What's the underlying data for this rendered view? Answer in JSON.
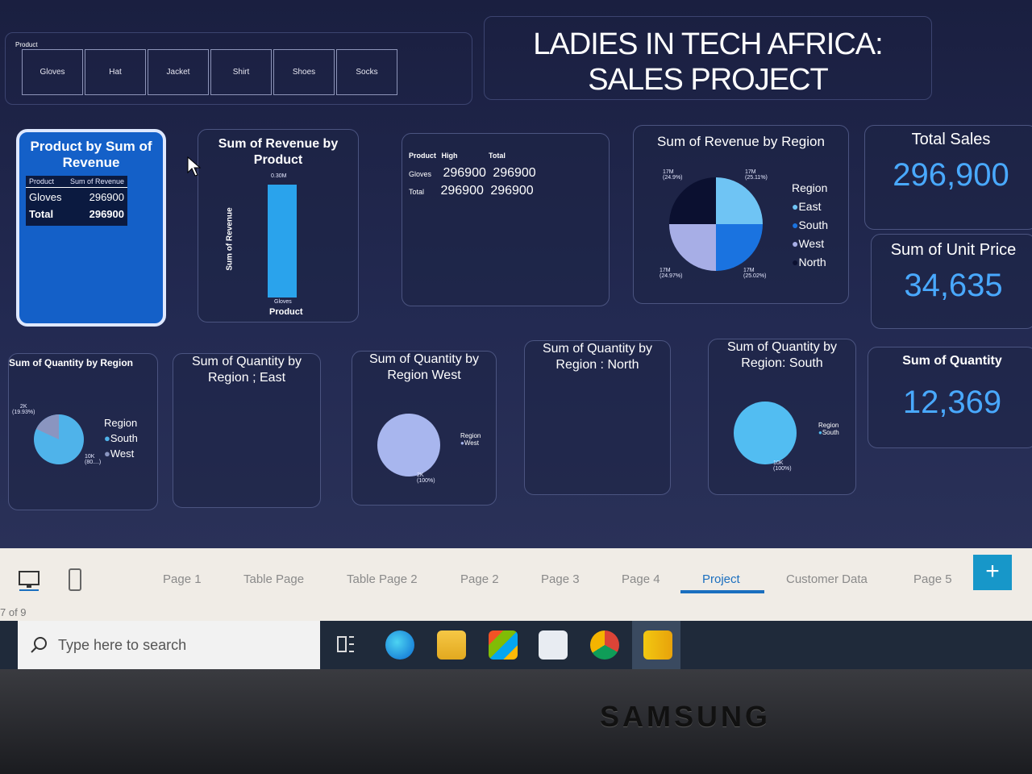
{
  "slicer": {
    "label": "Product",
    "items": [
      "Gloves",
      "Hat",
      "Jacket",
      "Shirt",
      "Shoes",
      "Socks"
    ]
  },
  "title": {
    "line1": "LADIES IN TECH AFRICA:",
    "line2": "SALES PROJECT"
  },
  "table_card": {
    "title": "Product by Sum of Revenue",
    "col1": "Product",
    "col2": "Sum of Revenue",
    "rows": [
      {
        "product": "Gloves",
        "value": "296900"
      },
      {
        "product": "Total",
        "value": "296900"
      }
    ]
  },
  "bar_card": {
    "title": "Sum of Revenue by Product",
    "ylabel": "Sum of Revenue",
    "xlabel": "Product",
    "bar_label": "0.30M",
    "category": "Gloves"
  },
  "matrix_card": {
    "col1": "Product",
    "col2": "High",
    "col3": "Total",
    "rows": [
      {
        "label": "Gloves",
        "v1": "296900",
        "v2": "296900"
      },
      {
        "label": "Total",
        "v1": "296900",
        "v2": "296900"
      }
    ]
  },
  "region_rev_card": {
    "title": "Sum of Revenue by Region",
    "legend_title": "Region",
    "legend": [
      "East",
      "South",
      "West",
      "North"
    ],
    "labels": [
      "17M (24.9%)",
      "17M (25.11%)",
      "17M (25.02%)",
      "17M (24.97%)"
    ]
  },
  "kpis": {
    "total_sales_title": "Total Sales",
    "total_sales": "296,900",
    "unit_price_title": "Sum of Unit Price",
    "unit_price": "34,635",
    "quantity_title": "Sum of Quantity",
    "quantity": "12,369"
  },
  "qty_region": {
    "title": "Sum of Quantity by Region",
    "legend_title": "Region",
    "legend": [
      "South",
      "West"
    ],
    "label_a": "2K",
    "label_a2": "(19.93%)",
    "label_b": "10K",
    "label_b2": "(80....)"
  },
  "qty_east": {
    "title": "Sum of Quantity by Region ; East"
  },
  "qty_west": {
    "title": "Sum of Quantity by Region West",
    "legend_title": "Region",
    "legend": "West",
    "label": "2K",
    "label2": "(100%)"
  },
  "qty_north": {
    "title": "Sum of Quantity by Region : North"
  },
  "qty_south": {
    "title": "Sum of Quantity by Region: South",
    "legend_title": "Region",
    "legend": "South",
    "label": "10K",
    "label2": "(100%)"
  },
  "tabs": [
    "Page 1",
    "Table Page",
    "Table Page 2",
    "Page 2",
    "Page 3",
    "Page 4",
    "Project",
    "Customer Data",
    "Page 5"
  ],
  "active_tab": "Project",
  "page_indicator": "7 of 9",
  "taskbar": {
    "search_placeholder": "Type here to search"
  },
  "brand": "SAMSUNG",
  "colors": {
    "accent": "#49a9ff",
    "tab_active": "#1b6fbf",
    "card_blue": "#1460c8"
  }
}
